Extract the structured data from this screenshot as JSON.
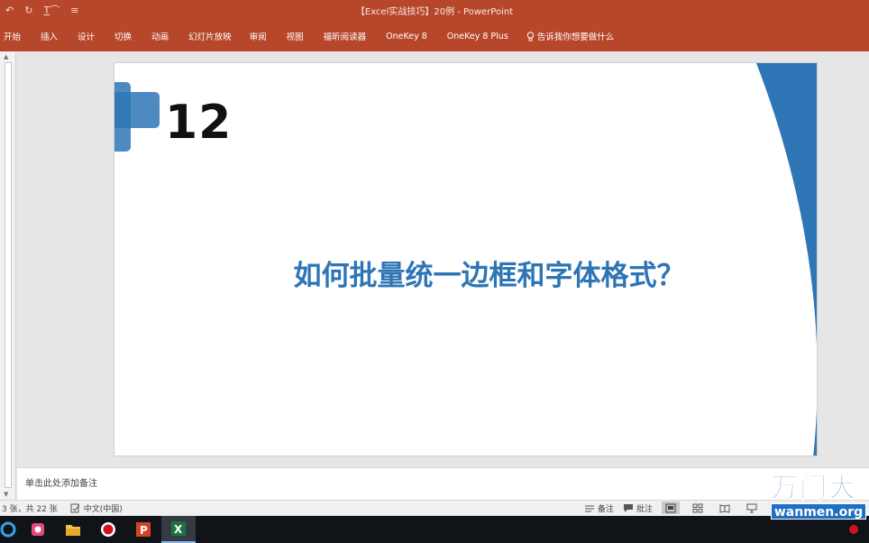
{
  "window": {
    "title": "【Excel实战技巧】20例  -  PowerPoint",
    "qat_touch_label": "T"
  },
  "ribbon": {
    "tabs": [
      "开始",
      "插入",
      "设计",
      "切换",
      "动画",
      "幻灯片放映",
      "审阅",
      "视图",
      "福昕阅读器",
      "OneKey 8",
      "OneKey 8 Plus"
    ],
    "tell_me": "告诉我你想要做什么"
  },
  "slide": {
    "number": "12",
    "title": "如何批量统一边框和字体格式？"
  },
  "notes": {
    "placeholder": "单击此处添加备注"
  },
  "status": {
    "slide_count": "3 张，共 22 张",
    "language": "中文(中国)",
    "notes_label": "备注",
    "comments_label": "批注"
  },
  "watermark": {
    "brand": "万门大",
    "url": "wanmen.org"
  },
  "colors": {
    "accent_ppt": "#b7472a",
    "slide_blue": "#2e75b6"
  }
}
